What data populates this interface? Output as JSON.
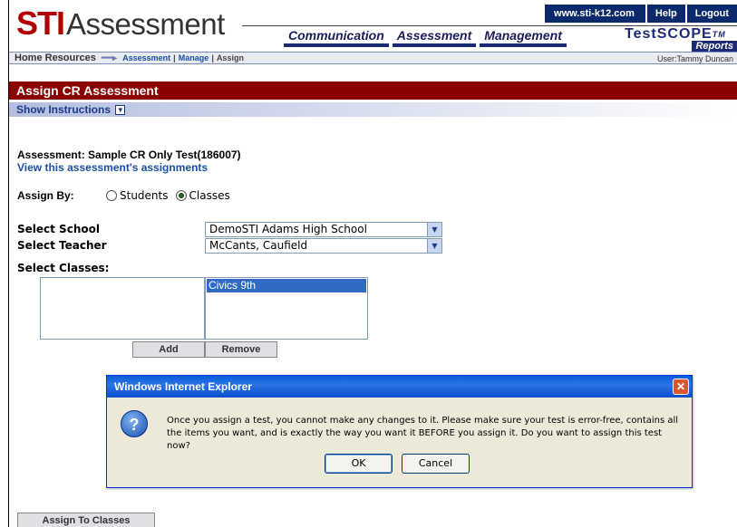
{
  "header": {
    "logo_sti": "STI",
    "logo_product": "Assessment",
    "top_links": [
      "www.sti-k12.com",
      "Help",
      "Logout"
    ],
    "nav": [
      "Communication",
      "Assessment",
      "Management"
    ],
    "testscope": "TestSCOPE",
    "testscope_tm": "TM",
    "testscope_sub": "Reports"
  },
  "breadcrumb": {
    "home": "Home",
    "resources": "Resources",
    "assessment": "Assessment",
    "sep": "|",
    "manage": "Manage",
    "assign": "Assign",
    "user": "User:Tammy Duncan"
  },
  "page": {
    "title": "Assign CR Assessment",
    "instructions": "Show Instructions",
    "assessment_label": "Assessment: Sample CR Only Test(186007)",
    "assignments_link": "View this assessment's assignments",
    "assign_by_label": "Assign By:",
    "radio_students": "Students",
    "radio_classes": "Classes",
    "assign_by_value": "Classes",
    "school_label": "Select School",
    "school_value": "DemoSTI Adams High School",
    "teacher_label": "Select Teacher",
    "teacher_value": "McCants, Caufield",
    "classes_label": "Select Classes:",
    "available_classes": [],
    "selected_classes": [
      "Civics 9th"
    ],
    "add_button": "Add",
    "remove_button": "Remove",
    "assign_button": "Assign To Classes"
  },
  "dialog": {
    "title": "Windows Internet Explorer",
    "message": "Once you assign a test, you cannot make any changes to it.  Please make sure your test is error-free, contains all the items you want, and is exactly the way you want it BEFORE you assign it.  Do you want to assign this test now?",
    "ok": "OK",
    "cancel": "Cancel"
  },
  "colors": {
    "title_bar": "#8b0000",
    "link_blue": "#1a4fa0",
    "nav_blue": "#1c2a76",
    "dialog_title": "#0a5cd8"
  },
  "icons": {
    "dialog_icon": "question-icon",
    "close": "close-icon",
    "dropdown": "chevron-down-icon",
    "expand": "double-chevron-down-icon"
  }
}
